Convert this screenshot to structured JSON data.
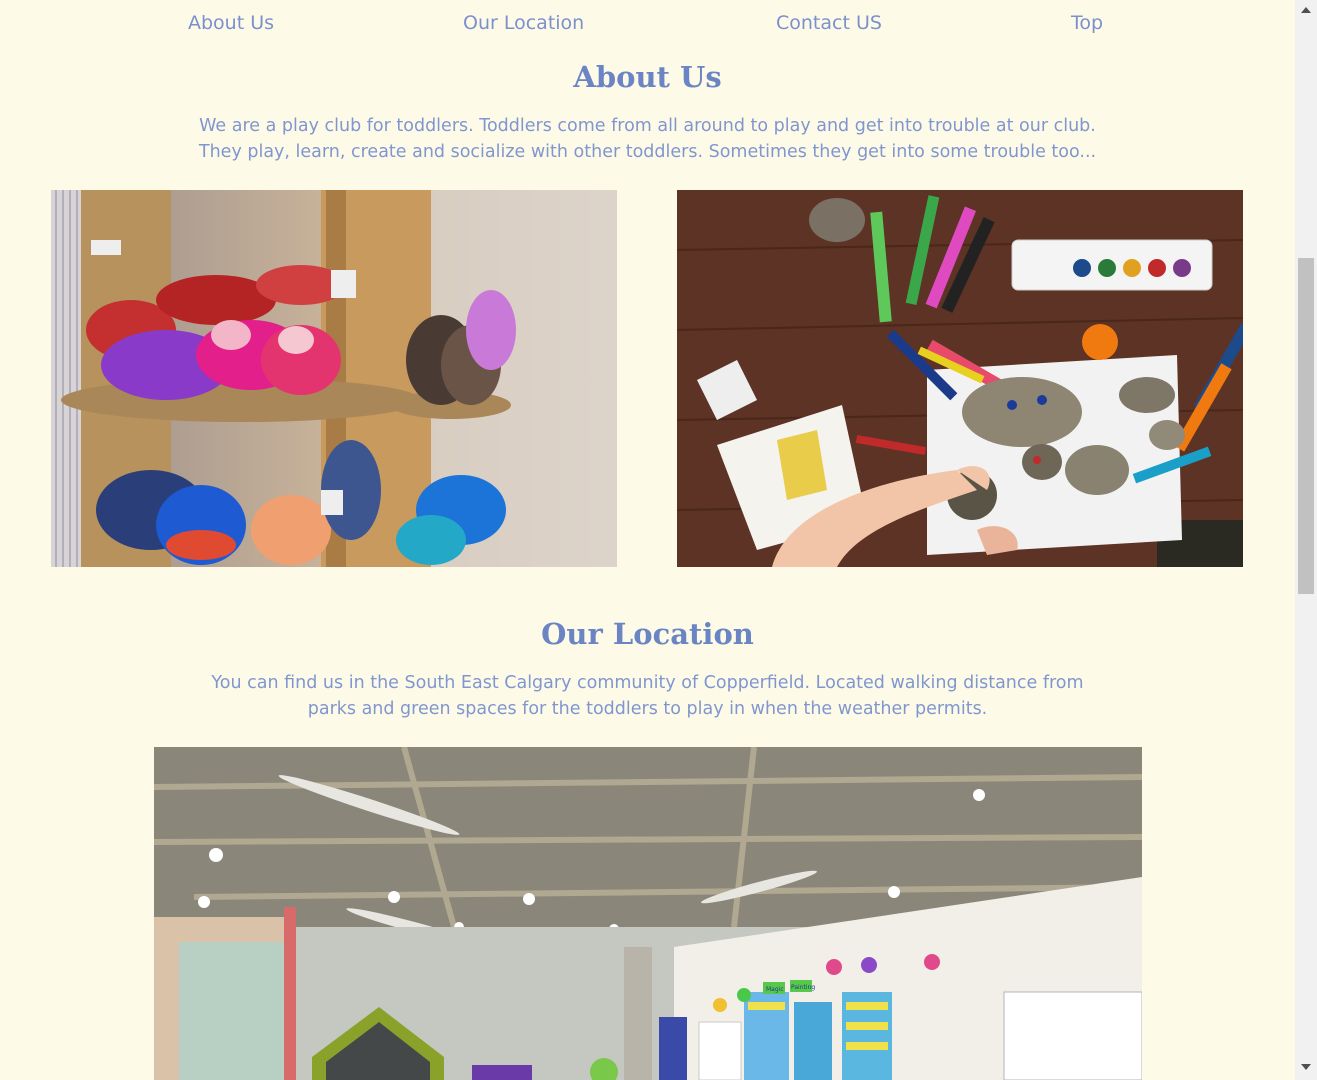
{
  "nav": {
    "items": [
      {
        "label": "About Us"
      },
      {
        "label": "Our Location"
      },
      {
        "label": "Contact US"
      },
      {
        "label": "Top"
      }
    ]
  },
  "about": {
    "title": "About Us",
    "line1": "We are a play club for toddlers. Toddlers come from all around to play and get into trouble at our club.",
    "line2": "They play, learn, create and socialize with other toddlers. Sometimes they get into some trouble too..."
  },
  "location": {
    "title": "Our Location",
    "line1": "You can find us in the South East Calgary community of Copperfield. Located walking distance from",
    "line2": "parks and green spaces for the toddlers to play in when the weather permits.",
    "poster_label_1": "Magic",
    "poster_label_2": "Painting"
  },
  "colors": {
    "background": "#fdfbe8",
    "accent": "#6b84c4"
  }
}
